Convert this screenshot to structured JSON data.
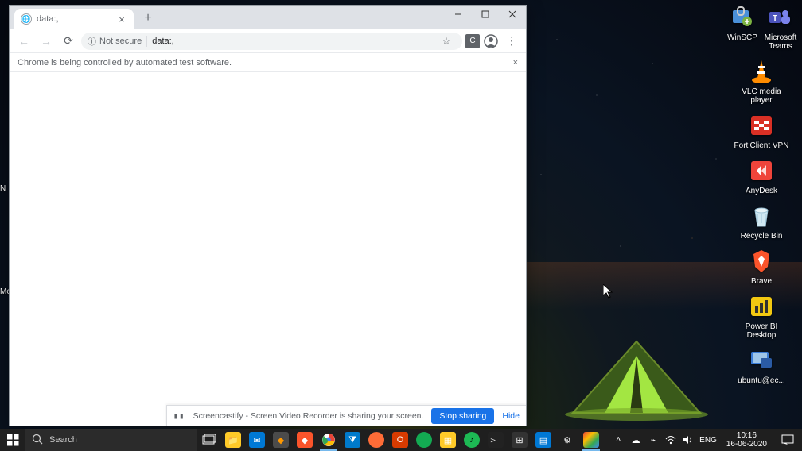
{
  "chrome": {
    "tab": {
      "title": "data:,"
    },
    "security_label": "Not secure",
    "url": "data:,",
    "infobar_msg": "Chrome is being controlled by automated test software.",
    "share": {
      "text": "Screencastify - Screen Video Recorder is sharing your screen.",
      "stop": "Stop sharing",
      "hide": "Hide"
    },
    "ext_letter": "C"
  },
  "desktop_icons_right": [
    {
      "name": "winscp",
      "label": "WinSCP"
    },
    {
      "name": "teams",
      "label": "Microsoft Teams"
    },
    {
      "name": "vlc",
      "label": "VLC media player"
    },
    {
      "name": "forticlient",
      "label": "FortiClient VPN"
    },
    {
      "name": "anydesk",
      "label": "AnyDesk"
    },
    {
      "name": "recyclebin",
      "label": "Recycle Bin"
    },
    {
      "name": "brave",
      "label": "Brave"
    },
    {
      "name": "powerbi",
      "label": "Power BI Desktop"
    },
    {
      "name": "ubuntu",
      "label": "ubuntu@ec..."
    }
  ],
  "desktop_icons_left": [
    {
      "name": "partial1",
      "label": "N"
    },
    {
      "name": "partial2",
      "label": "Mc"
    }
  ],
  "taskbar": {
    "search_placeholder": "Search",
    "lang": "ENG",
    "time": "10:16",
    "date": "16-06-2020",
    "items": [
      "taskview",
      "explorer",
      "mail",
      "sublime",
      "brave",
      "chrome",
      "vscode",
      "postman",
      "office",
      "mongodb",
      "notes",
      "spotify",
      "cmd",
      "calc",
      "vm",
      "settings",
      "chrome2"
    ]
  }
}
